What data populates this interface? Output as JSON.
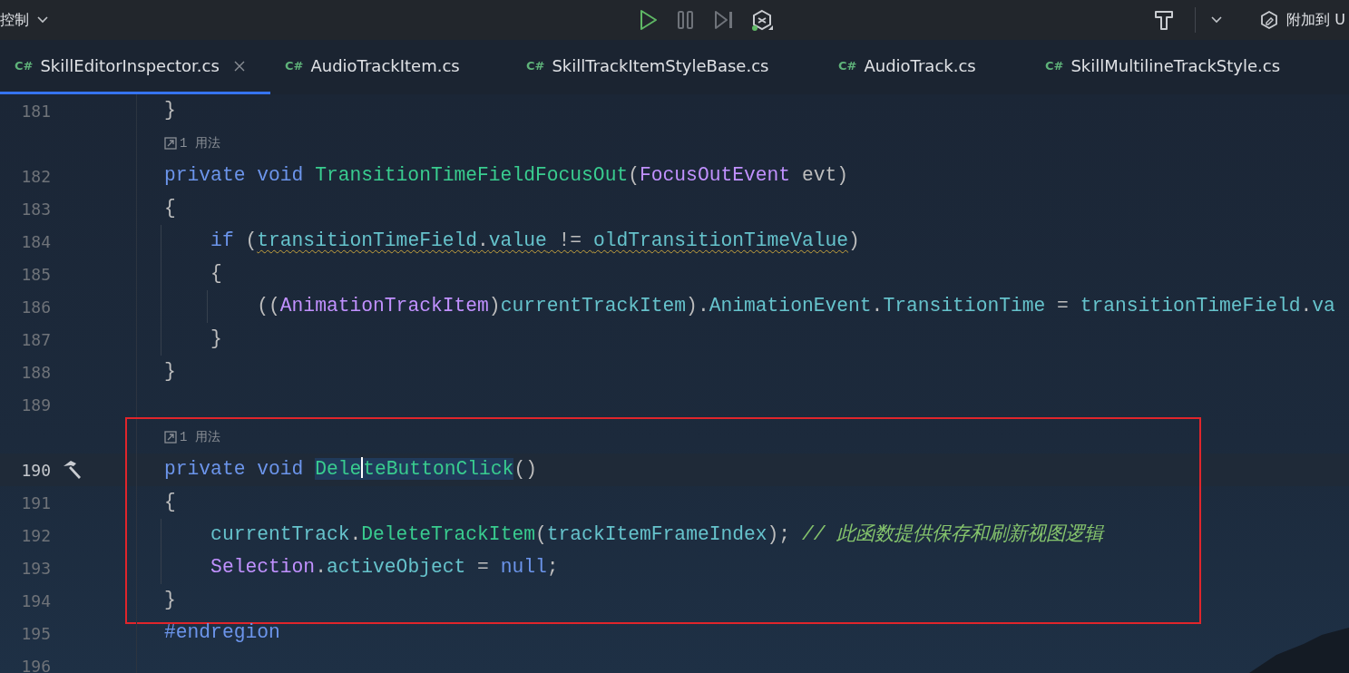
{
  "toolbar": {
    "menu": {
      "label": "控制"
    },
    "buttons": [
      {
        "kind": "play",
        "disabled": false
      },
      {
        "kind": "pause",
        "disabled": true
      },
      {
        "kind": "step",
        "disabled": true
      },
      {
        "kind": "debug",
        "disabled": false
      }
    ],
    "attach": {
      "label": "附加到 U"
    }
  },
  "tabs": [
    {
      "icon_text": "C#",
      "label": "SkillEditorInspector.cs",
      "selected": true,
      "close_button": true
    },
    {
      "icon_text": "C#",
      "label": "AudioTrackItem.cs",
      "selected": false,
      "close_button": false
    },
    {
      "icon_text": "C#",
      "label": "SkillTrackItemStyleBase.cs",
      "selected": false,
      "close_button": false
    },
    {
      "icon_text": "C#",
      "label": "AudioTrack.cs",
      "selected": false,
      "close_button": false
    },
    {
      "icon_text": "C#",
      "label": "SkillMultilineTrackStyle.cs",
      "selected": false,
      "close_button": false
    }
  ],
  "editor": {
    "sections": [
      {
        "boxed": false,
        "lines": [
          {
            "kind": "code",
            "number": "181",
            "tokens": [
              {
                "kind": "punct",
                "text": "}"
              }
            ]
          },
          {
            "kind": "hint",
            "text": "1 用法"
          },
          {
            "kind": "code",
            "number": "182",
            "tokens": [
              {
                "kind": "keyword",
                "text": "private"
              },
              {
                "kind": "keyword",
                "text": "void",
                "space_before": true
              },
              {
                "kind": "method",
                "text": "TransitionTimeFieldFocusOut",
                "space_before": true
              },
              {
                "kind": "punct",
                "text": "("
              },
              {
                "kind": "type",
                "text": "FocusOutEvent"
              },
              {
                "kind": "punct",
                "text": " evt)"
              }
            ]
          },
          {
            "kind": "code",
            "number": "183",
            "tokens": [
              {
                "kind": "punct",
                "text": "{"
              }
            ],
            "children": [
              {
                "kind": "code",
                "number": "184",
                "tokens": [
                  {
                    "kind": "keyword",
                    "text": "if"
                  },
                  {
                    "kind": "punct",
                    "text": " ("
                  },
                  {
                    "kind": "field",
                    "text": "transitionTimeField",
                    "warning": true
                  },
                  {
                    "kind": "punct",
                    "text": ".",
                    "warning": true
                  },
                  {
                    "kind": "field",
                    "text": "value",
                    "warning": true
                  },
                  {
                    "kind": "punct",
                    "text": " != ",
                    "warning": true
                  },
                  {
                    "kind": "field",
                    "text": "oldTransitionTimeValue",
                    "warning": true
                  },
                  {
                    "kind": "punct",
                    "text": ")"
                  }
                ]
              },
              {
                "kind": "code",
                "number": "185",
                "tokens": [
                  {
                    "kind": "punct",
                    "text": "{"
                  }
                ],
                "children": [
                  {
                    "kind": "code",
                    "number": "186",
                    "tokens": [
                      {
                        "kind": "punct",
                        "text": "(("
                      },
                      {
                        "kind": "type",
                        "text": "AnimationTrackItem"
                      },
                      {
                        "kind": "punct",
                        "text": ")"
                      },
                      {
                        "kind": "field",
                        "text": "currentTrackItem"
                      },
                      {
                        "kind": "punct",
                        "text": ")."
                      },
                      {
                        "kind": "field",
                        "text": "AnimationEvent"
                      },
                      {
                        "kind": "punct",
                        "text": "."
                      },
                      {
                        "kind": "field",
                        "text": "TransitionTime"
                      },
                      {
                        "kind": "punct",
                        "text": " = "
                      },
                      {
                        "kind": "field",
                        "text": "transitionTimeField"
                      },
                      {
                        "kind": "punct",
                        "text": "."
                      },
                      {
                        "kind": "field",
                        "text": "va"
                      }
                    ]
                  }
                ]
              },
              {
                "kind": "code",
                "number": "187",
                "tokens": [
                  {
                    "kind": "punct",
                    "text": "}"
                  }
                ]
              }
            ]
          },
          {
            "kind": "code",
            "number": "188",
            "tokens": [
              {
                "kind": "punct",
                "text": "}"
              }
            ]
          },
          {
            "kind": "code",
            "number": "189"
          }
        ]
      },
      {
        "boxed": true,
        "lines": [
          {
            "kind": "hint",
            "text": "1 用法"
          },
          {
            "kind": "code",
            "number": "190",
            "current": true,
            "build_marker": true,
            "tokens": [
              {
                "kind": "keyword",
                "text": "private"
              },
              {
                "kind": "keyword",
                "text": "void",
                "space_before": true
              },
              {
                "kind": "method",
                "text": "Dele",
                "space_before": true,
                "highlighted": true,
                "text_after_caret": "teButtonClick"
              },
              {
                "kind": "punct",
                "text": "()"
              }
            ]
          },
          {
            "kind": "code",
            "number": "191",
            "tokens": [
              {
                "kind": "punct",
                "text": "{"
              }
            ],
            "children": [
              {
                "kind": "code",
                "number": "192",
                "tokens": [
                  {
                    "kind": "field",
                    "text": "currentTrack"
                  },
                  {
                    "kind": "punct",
                    "text": "."
                  },
                  {
                    "kind": "method",
                    "text": "DeleteTrackItem"
                  },
                  {
                    "kind": "punct",
                    "text": "("
                  },
                  {
                    "kind": "field",
                    "text": "trackItemFrameIndex"
                  },
                  {
                    "kind": "punct",
                    "text": "); "
                  },
                  {
                    "kind": "comment",
                    "text": "// 此函数提供保存和刷新视图逻辑"
                  }
                ]
              },
              {
                "kind": "code",
                "number": "193",
                "tokens": [
                  {
                    "kind": "type",
                    "text": "Selection"
                  },
                  {
                    "kind": "punct",
                    "text": "."
                  },
                  {
                    "kind": "field",
                    "text": "activeObject"
                  },
                  {
                    "kind": "punct",
                    "text": " = "
                  },
                  {
                    "kind": "keyword",
                    "text": "null"
                  },
                  {
                    "kind": "punct",
                    "text": ";"
                  }
                ]
              }
            ]
          },
          {
            "kind": "code",
            "number": "194",
            "tokens": [
              {
                "kind": "punct",
                "text": "}"
              }
            ]
          }
        ]
      },
      {
        "boxed": false,
        "lines": [
          {
            "kind": "code",
            "number": "195",
            "tokens": [
              {
                "kind": "keyword",
                "text": "#endregion"
              }
            ]
          },
          {
            "kind": "code",
            "number": "196"
          }
        ]
      }
    ]
  }
}
